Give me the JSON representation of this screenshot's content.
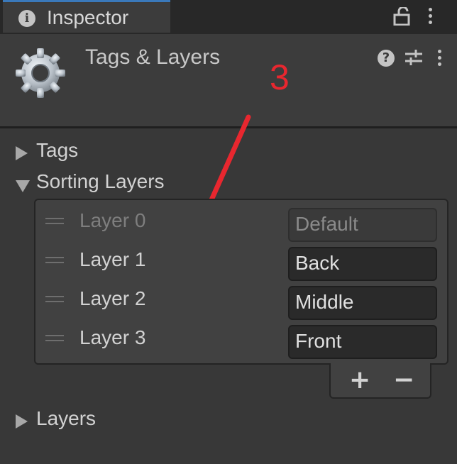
{
  "tab": {
    "title": "Inspector",
    "info_icon": "info-icon",
    "lock_icon": "lock-icon",
    "menu_icon": "kebab-menu-icon"
  },
  "header": {
    "title": "Tags & Layers",
    "icon": "gear-icon",
    "help_icon": "help-icon",
    "presets_icon": "presets-icon",
    "menu_icon": "kebab-menu-icon"
  },
  "annotation": {
    "text": "3",
    "color": "#e8272f"
  },
  "foldouts": {
    "tags": "Tags",
    "sorting_layers": "Sorting Layers",
    "layers": "Layers"
  },
  "sorting_layers": {
    "rows": [
      {
        "label": "Layer 0",
        "value": "Default",
        "disabled": true
      },
      {
        "label": "Layer 1",
        "value": "Back",
        "disabled": false
      },
      {
        "label": "Layer 2",
        "value": "Middle",
        "disabled": false
      },
      {
        "label": "Layer 3",
        "value": "Front",
        "disabled": false
      }
    ],
    "add_label": "+",
    "remove_label": "−"
  },
  "colors": {
    "tab_accent": "#3a79bb",
    "background": "#383838",
    "field": "#2a2a2a"
  }
}
